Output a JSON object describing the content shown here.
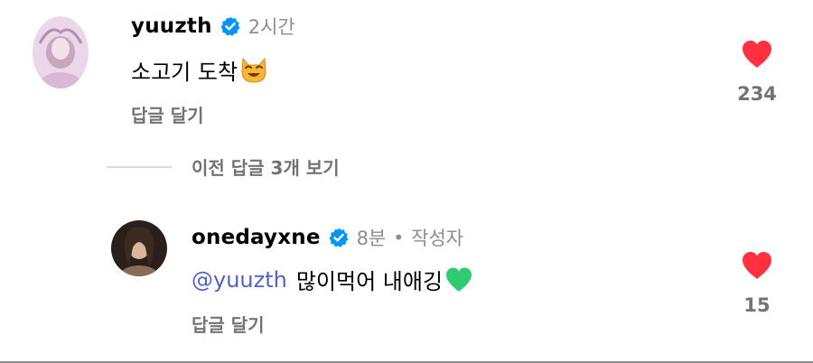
{
  "comments": [
    {
      "username": "yuuzth",
      "time": "2시간",
      "text": "소고기 도착",
      "emoji": "smiling-cat-heart-eyes-icon",
      "reply_label": "답글 달기",
      "likes": "234",
      "verified": true
    },
    {
      "username": "onedayxne",
      "time": "8분",
      "author_badge": "작성자",
      "mention": "@yuuzth",
      "text": "많이먹어 내애깅",
      "emoji": "green-heart-icon",
      "reply_label": "답글 달기",
      "likes": "15",
      "verified": true
    }
  ],
  "view_previous_replies": "이전 답글 3개 보기",
  "colors": {
    "like_red": "#ff3040",
    "verified_blue": "#0095f6",
    "mention_blue": "#4f63c6",
    "secondary_text": "#737373"
  }
}
